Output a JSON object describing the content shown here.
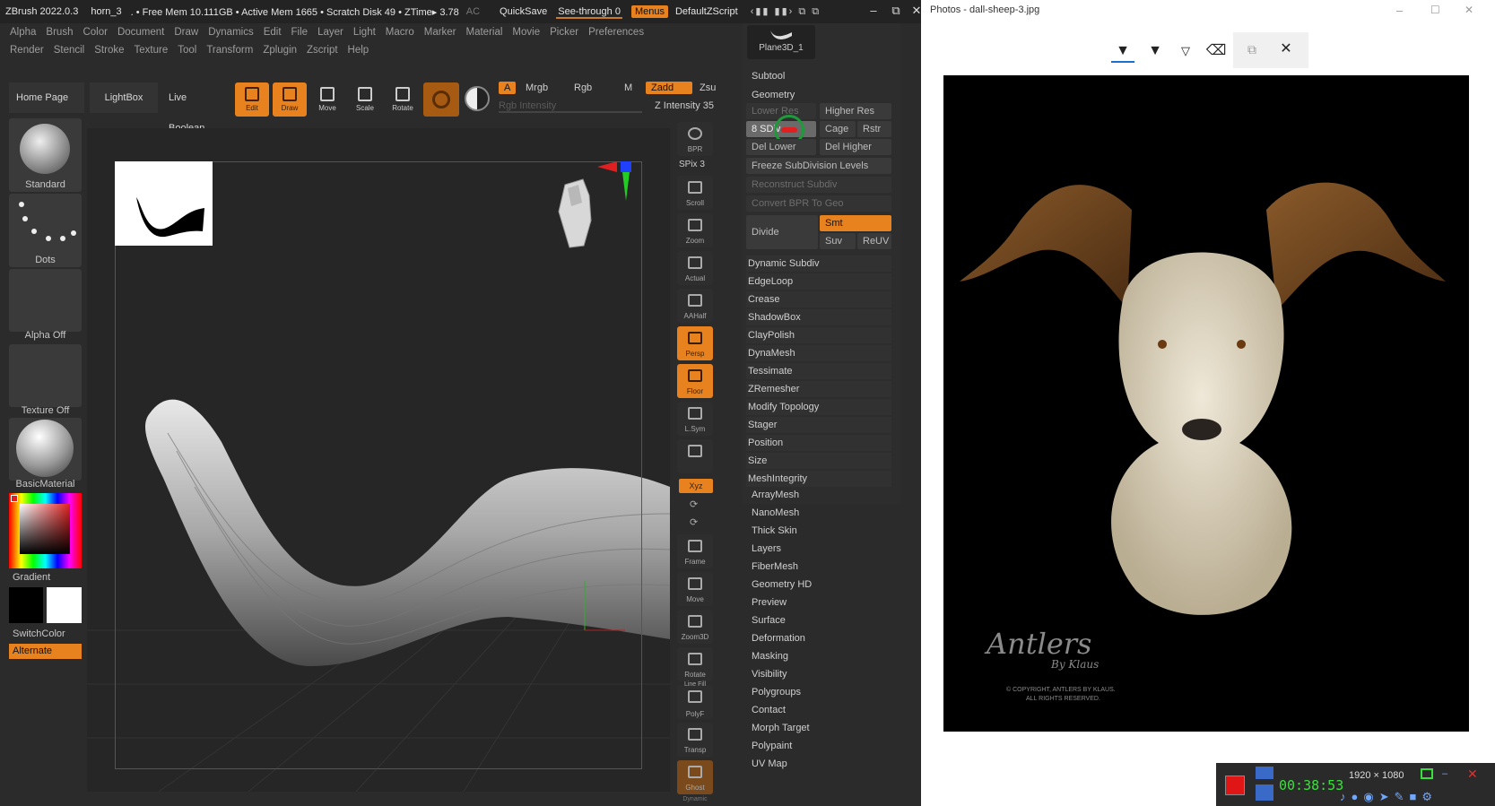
{
  "zbrush": {
    "title": {
      "app": "ZBrush 2022.0.3",
      "doc": "horn_3",
      "mem": ". • Free Mem 10.111GB • Active Mem 1665 • Scratch Disk 49 • ZTime▸ 3.78",
      "ac": "AC",
      "quicksave": "QuickSave",
      "seethrough": "See-through  0",
      "menus": "Menus",
      "zscript": "DefaultZScript"
    },
    "menu_row1": [
      "Alpha",
      "Brush",
      "Color",
      "Document",
      "Draw",
      "Dynamics",
      "Edit",
      "File",
      "Layer",
      "Light",
      "Macro",
      "Marker",
      "Material",
      "Movie",
      "Picker",
      "Preferences"
    ],
    "menu_row2": [
      "Render",
      "Stencil",
      "Stroke",
      "Texture",
      "Tool",
      "Transform",
      "Zplugin",
      "Zscript",
      "Help"
    ],
    "shelf": {
      "home": "Home Page",
      "lightbox": "LightBox",
      "liveboolean": "Live Boolean",
      "tools": [
        "Edit",
        "Draw",
        "Move",
        "Scale",
        "Rotate"
      ],
      "a": "A",
      "mrgb": "Mrgb",
      "rgb": "Rgb",
      "m": "M",
      "zadd": "Zadd",
      "zsub": "Zsu",
      "rgb_intensity": "Rgb Intensity",
      "z_intensity": "Z Intensity 35"
    },
    "left": {
      "brush": "Standard",
      "stroke": "Dots",
      "alpha": "Alpha Off",
      "texture": "Texture Off",
      "material": "BasicMaterial",
      "gradient": "Gradient",
      "switchcolor": "SwitchColor",
      "alternate": "Alternate"
    },
    "right_tools": {
      "bpr": "BPR",
      "spix": "SPix 3",
      "scroll": "Scroll",
      "zoom": "Zoom",
      "actual": "Actual",
      "aahalf": "AAHalf",
      "dynamic": "Dynamic",
      "persp": "Persp",
      "floor": "Floor",
      "lsym": "L.Sym",
      "xyz": "Xyz",
      "frame": "Frame",
      "move": "Move",
      "zoom3d": "Zoom3D",
      "rotate": "Rotate",
      "linefill": "Line Fill",
      "polyf": "PolyF",
      "transp": "Transp",
      "ghost": "Ghost",
      "dynamic2": "Dynamic"
    },
    "panel": {
      "subtool_name": "Plane3D_1",
      "subtool": "Subtool",
      "geometry": "Geometry",
      "lower_res": "Lower Res",
      "higher_res": "Higher Res",
      "sdiv": "8 SDiv",
      "cage": "Cage",
      "rstr": "Rstr",
      "del_lower": "Del Lower",
      "del_higher": "Del Higher",
      "freeze": "Freeze SubDivision Levels",
      "reconstruct": "Reconstruct Subdiv",
      "convert": "Convert BPR To Geo",
      "divide": "Divide",
      "smt": "Smt",
      "suv": "Suv",
      "reuv": "ReUV",
      "geo_items": [
        "Dynamic Subdiv",
        "EdgeLoop",
        "Crease",
        "ShadowBox",
        "ClayPolish",
        "DynaMesh",
        "Tessimate",
        "ZRemesher",
        "Modify Topology",
        "Stager",
        "Position",
        "Size",
        "MeshIntegrity"
      ],
      "tool_items": [
        "ArrayMesh",
        "NanoMesh",
        "Thick Skin",
        "Layers",
        "FiberMesh",
        "Geometry HD",
        "Preview",
        "Surface",
        "Deformation",
        "Masking",
        "Visibility",
        "Polygroups",
        "Contact",
        "Morph Target",
        "Polypaint",
        "UV Map"
      ]
    },
    "colors": {
      "accent": "#e8821e",
      "bg": "#2b2b2b",
      "panel": "#2d2d2d"
    }
  },
  "photos": {
    "title": "Photos - dall-sheep-3.jpg",
    "toolbar_icons": [
      "draw-pen-icon",
      "highlighter-icon",
      "calligraphy-pen-icon",
      "eraser-icon",
      "copy-icon",
      "close-icon"
    ],
    "watermark": {
      "brand": "Antlers",
      "byline": "By Klaus",
      "copyright1": "© COPYRIGHT, ANTLERS BY KLAUS.",
      "copyright2": "ALL RIGHTS RESERVED."
    }
  },
  "recorder": {
    "timer": "00:38:53",
    "resolution": "1920 × 1080"
  }
}
